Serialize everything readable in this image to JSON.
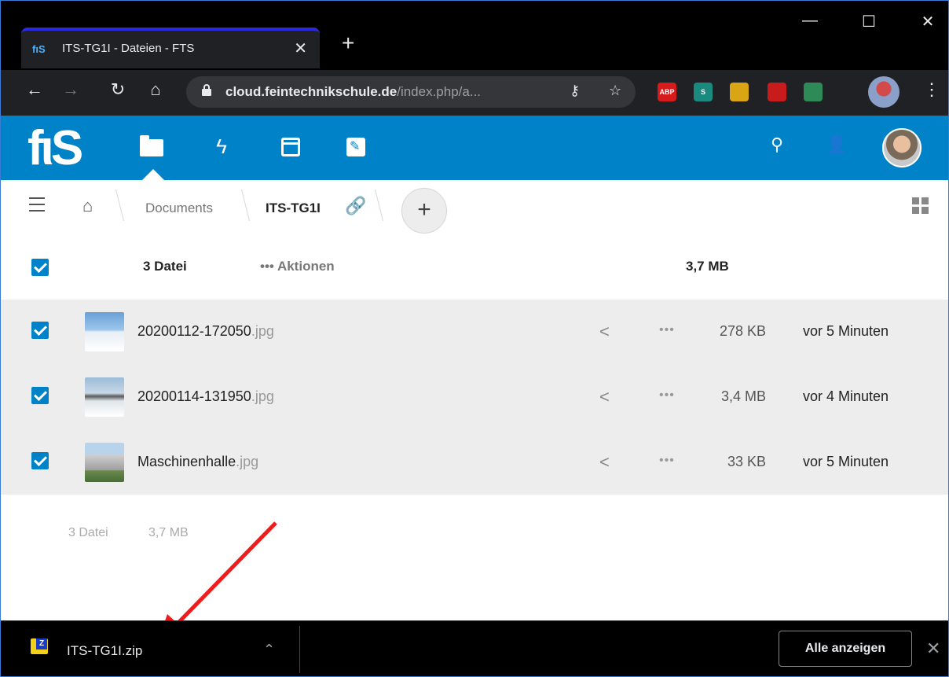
{
  "browser": {
    "tab_title": "ITS-TG1I - Dateien - FTS",
    "tab_favicon_text": "fıS",
    "url_host": "cloud.feintechnikschule.de",
    "url_rest": "/index.php/a...",
    "extensions": [
      {
        "name": "adblock-plus-icon",
        "label": "ABP",
        "color": "#d51b1b"
      },
      {
        "name": "stylus-extension-icon",
        "label": "S",
        "color": "#1a8a7e"
      },
      {
        "name": "sun-extension-icon",
        "label": "",
        "color": "#d9a514"
      },
      {
        "name": "pdf-extension-icon",
        "label": "",
        "color": "#c81b1b"
      },
      {
        "name": "translate-extension-icon",
        "label": "",
        "color": "#2e8b57"
      }
    ]
  },
  "app": {
    "logo_text": "fιS",
    "accent": "#0082c9",
    "nav_icons": [
      "folder-icon",
      "activity-icon",
      "calendar-icon",
      "notes-icon"
    ]
  },
  "breadcrumb": {
    "items": [
      "Documents",
      "ITS-TG1I"
    ]
  },
  "list_header": {
    "count": "3 Datei",
    "actions": "••• Aktionen",
    "size": "3,7 MB"
  },
  "files": [
    {
      "name": "20200112-172050",
      "ext": ".jpg",
      "size": "278 KB",
      "date": "vor 5 Minuten",
      "thumb": "linear-gradient(180deg,#6aa0d8 0%,#9cc6ea 45%,#e6eef5 50%,#ffffff 100%)"
    },
    {
      "name": "20200114-131950",
      "ext": ".jpg",
      "size": "3,4 MB",
      "date": "vor 4 Minuten",
      "thumb": "linear-gradient(180deg,#9bbbd8 0%,#c8d8e6 40%,#5a5a5a 48%,#dfe5ea 60%,#ffffff 100%)"
    },
    {
      "name": "Maschinenhalle",
      "ext": ".jpg",
      "size": "33 KB",
      "date": "vor 5 Minuten",
      "thumb": "linear-gradient(180deg,#b8d4ec 0%,#b8d4ec 30%,#cfcfcf 31%,#9e9e9e 70%,#6a8a4a 71%,#4a6a3a 100%)"
    }
  ],
  "summary": {
    "count": "3 Datei",
    "size": "3,7 MB"
  },
  "download_bar": {
    "file": "ITS-TG1I.zip",
    "show_all": "Alle anzeigen"
  }
}
